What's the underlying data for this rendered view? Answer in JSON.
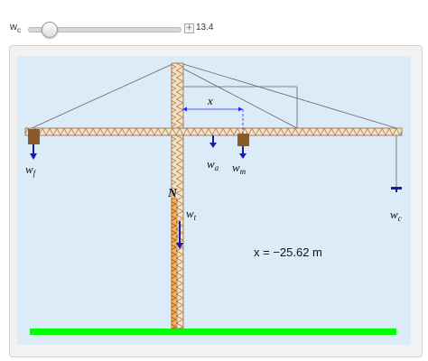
{
  "control": {
    "label_main": "w",
    "label_sub": "c",
    "value": "13.4",
    "thumb_fraction": 0.1,
    "plus_glyph": "+"
  },
  "diagram": {
    "readout": "x = −25.62 m",
    "x_label": "x",
    "loads": {
      "wf": {
        "main": "w",
        "sub": "f"
      },
      "wa": {
        "main": "w",
        "sub": "a"
      },
      "wm": {
        "main": "w",
        "sub": "m"
      },
      "wc": {
        "main": "w",
        "sub": "c"
      },
      "wt": {
        "main": "w",
        "sub": "t"
      }
    },
    "n_label": "N",
    "colors": {
      "sky": "#dcebf8",
      "ground": "#00ff00",
      "arrow": "#1a1aa8",
      "weight_block": "#8a5a2b",
      "truss_orange": "#e08a2c",
      "truss_tan": "#c8a070",
      "cable": "#666666",
      "dim_arrow": "#2a2aff"
    }
  }
}
